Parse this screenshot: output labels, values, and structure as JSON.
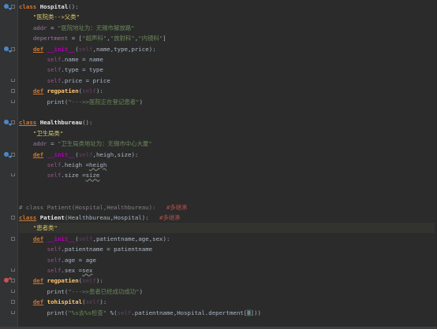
{
  "editor": {
    "lines": [
      {
        "tokens": [
          [
            "kw",
            "class "
          ],
          [
            "cls",
            "Hospital"
          ],
          [
            "plain",
            "():"
          ]
        ],
        "gutter": "override",
        "fold": "start"
      },
      {
        "tokens": [
          [
            "plain",
            "    "
          ],
          [
            "str-strong",
            "\"医院类-->父类\""
          ]
        ]
      },
      {
        "tokens": [
          [
            "plain",
            "    "
          ],
          [
            "var",
            "addr"
          ],
          [
            "plain",
            " = "
          ],
          [
            "str",
            "\"医院地址为：无锡市解放路\""
          ]
        ]
      },
      {
        "tokens": [
          [
            "plain",
            "    "
          ],
          [
            "var",
            "depertment"
          ],
          [
            "plain",
            " = ["
          ],
          [
            "str",
            "\"超声科\""
          ],
          [
            "plain",
            ","
          ],
          [
            "str",
            "\"放射科\""
          ],
          [
            "plain",
            ","
          ],
          [
            "str",
            "\"内镜科\""
          ],
          [
            "plain",
            "]"
          ]
        ]
      },
      {
        "tokens": [
          [
            "plain",
            "    "
          ],
          [
            "def-kw",
            "def"
          ],
          [
            "plain",
            " "
          ],
          [
            "dunder",
            "__init__"
          ],
          [
            "plain",
            "("
          ],
          [
            "self-p",
            "self"
          ],
          [
            "plain",
            ",name,type,price):"
          ]
        ],
        "gutter": "override",
        "fold": "start"
      },
      {
        "tokens": [
          [
            "plain",
            "        "
          ],
          [
            "self",
            "self"
          ],
          [
            "plain",
            ".name = name"
          ]
        ]
      },
      {
        "tokens": [
          [
            "plain",
            "        "
          ],
          [
            "self",
            "self"
          ],
          [
            "plain",
            ".type = type"
          ]
        ]
      },
      {
        "tokens": [
          [
            "plain",
            "        "
          ],
          [
            "self",
            "self"
          ],
          [
            "plain",
            ".price = price"
          ]
        ],
        "fold": "end"
      },
      {
        "tokens": [
          [
            "plain",
            "    "
          ],
          [
            "def-kw",
            "def"
          ],
          [
            "plain",
            " "
          ],
          [
            "fn",
            "regpatien"
          ],
          [
            "plain",
            "("
          ],
          [
            "self-p",
            "self"
          ],
          [
            "plain",
            "):"
          ]
        ],
        "fold": "start"
      },
      {
        "tokens": [
          [
            "plain",
            "        "
          ],
          [
            "plain",
            "print"
          ],
          [
            "plain",
            "("
          ],
          [
            "str",
            "\"--->>医院正在登记患者\""
          ],
          [
            "plain",
            ")"
          ]
        ],
        "fold": "end"
      },
      {
        "tokens": []
      },
      {
        "tokens": [
          [
            "def-kw",
            "class"
          ],
          [
            "plain",
            " "
          ],
          [
            "cls",
            "Healthbureau"
          ],
          [
            "plain",
            "():"
          ]
        ],
        "gutter": "override",
        "fold": "start"
      },
      {
        "tokens": [
          [
            "plain",
            "    "
          ],
          [
            "str-strong",
            "\"卫生局类\""
          ]
        ]
      },
      {
        "tokens": [
          [
            "plain",
            "    "
          ],
          [
            "var",
            "addr"
          ],
          [
            "plain",
            " = "
          ],
          [
            "str",
            "\"卫生局类地址为：无锡市中心大厦\""
          ]
        ]
      },
      {
        "tokens": [
          [
            "plain",
            "    "
          ],
          [
            "def-kw",
            "def"
          ],
          [
            "plain",
            " "
          ],
          [
            "dunder",
            "__init__"
          ],
          [
            "plain",
            "("
          ],
          [
            "self-p",
            "self"
          ],
          [
            "plain",
            ",heigh,size):"
          ]
        ],
        "gutter": "override",
        "fold": "start"
      },
      {
        "tokens": [
          [
            "plain",
            "        "
          ],
          [
            "self",
            "self"
          ],
          [
            "plain",
            ".heigh ="
          ],
          [
            "u-wave",
            "heigh"
          ]
        ]
      },
      {
        "tokens": [
          [
            "plain",
            "        "
          ],
          [
            "self",
            "self"
          ],
          [
            "plain",
            ".size ="
          ],
          [
            "u-wave",
            "size"
          ]
        ],
        "fold": "end"
      },
      {
        "tokens": []
      },
      {
        "tokens": []
      },
      {
        "tokens": [
          [
            "cmt",
            "# class Patient(Hospital,Healthbureau):   "
          ],
          [
            "cmt-cn",
            "#多继承"
          ]
        ]
      },
      {
        "tokens": [
          [
            "def-kw",
            "class"
          ],
          [
            "plain",
            " "
          ],
          [
            "cls",
            "Patient"
          ],
          [
            "plain",
            "(Healthbureau,Hospital):   "
          ],
          [
            "cmt-cn",
            "#多继承"
          ]
        ],
        "fold": "start"
      },
      {
        "tokens": [
          [
            "plain",
            "    "
          ],
          [
            "str-strong",
            "\"患者类\""
          ]
        ],
        "caret": true
      },
      {
        "tokens": [
          [
            "plain",
            "    "
          ],
          [
            "def-kw",
            "def"
          ],
          [
            "plain",
            " "
          ],
          [
            "dunder",
            "__init__"
          ],
          [
            "plain",
            "("
          ],
          [
            "self-p",
            "self"
          ],
          [
            "plain",
            ",patientname,age,sex):"
          ]
        ],
        "fold": "start"
      },
      {
        "tokens": [
          [
            "plain",
            "        "
          ],
          [
            "self",
            "self"
          ],
          [
            "plain",
            ".patientname = patientname"
          ]
        ]
      },
      {
        "tokens": [
          [
            "plain",
            "        "
          ],
          [
            "self",
            "self"
          ],
          [
            "plain",
            ".age = age"
          ]
        ]
      },
      {
        "tokens": [
          [
            "plain",
            "        "
          ],
          [
            "self",
            "self"
          ],
          [
            "plain",
            ".sex ="
          ],
          [
            "u-wave",
            "sex"
          ]
        ],
        "fold": "end"
      },
      {
        "tokens": [
          [
            "plain",
            "    "
          ],
          [
            "def-kw",
            "def"
          ],
          [
            "plain",
            " "
          ],
          [
            "fn",
            "regpatien"
          ],
          [
            "plain",
            "("
          ],
          [
            "self-p",
            "self"
          ],
          [
            "plain",
            "):"
          ]
        ],
        "gutter": "up",
        "fold": "start"
      },
      {
        "tokens": [
          [
            "plain",
            "        "
          ],
          [
            "plain",
            "print"
          ],
          [
            "plain",
            "("
          ],
          [
            "str",
            "\"--->>患者已经成功成功\""
          ],
          [
            "plain",
            ")"
          ]
        ],
        "fold": "end"
      },
      {
        "tokens": [
          [
            "plain",
            "    "
          ],
          [
            "def-kw",
            "def"
          ],
          [
            "plain",
            " "
          ],
          [
            "fn",
            "tohispital"
          ],
          [
            "plain",
            "("
          ],
          [
            "self-p",
            "self"
          ],
          [
            "plain",
            "):"
          ]
        ],
        "fold": "start"
      },
      {
        "tokens": [
          [
            "plain",
            "        "
          ],
          [
            "plain",
            "print"
          ],
          [
            "plain",
            "("
          ],
          [
            "str",
            "\"%s去%s检查\""
          ],
          [
            "plain",
            " %("
          ],
          [
            "self-p",
            "self"
          ],
          [
            "plain",
            ".patientname,Hospital.depertment["
          ],
          [
            "bracket-hl",
            "0"
          ],
          [
            "plain",
            "]))"
          ]
        ],
        "fold": "end"
      }
    ]
  }
}
